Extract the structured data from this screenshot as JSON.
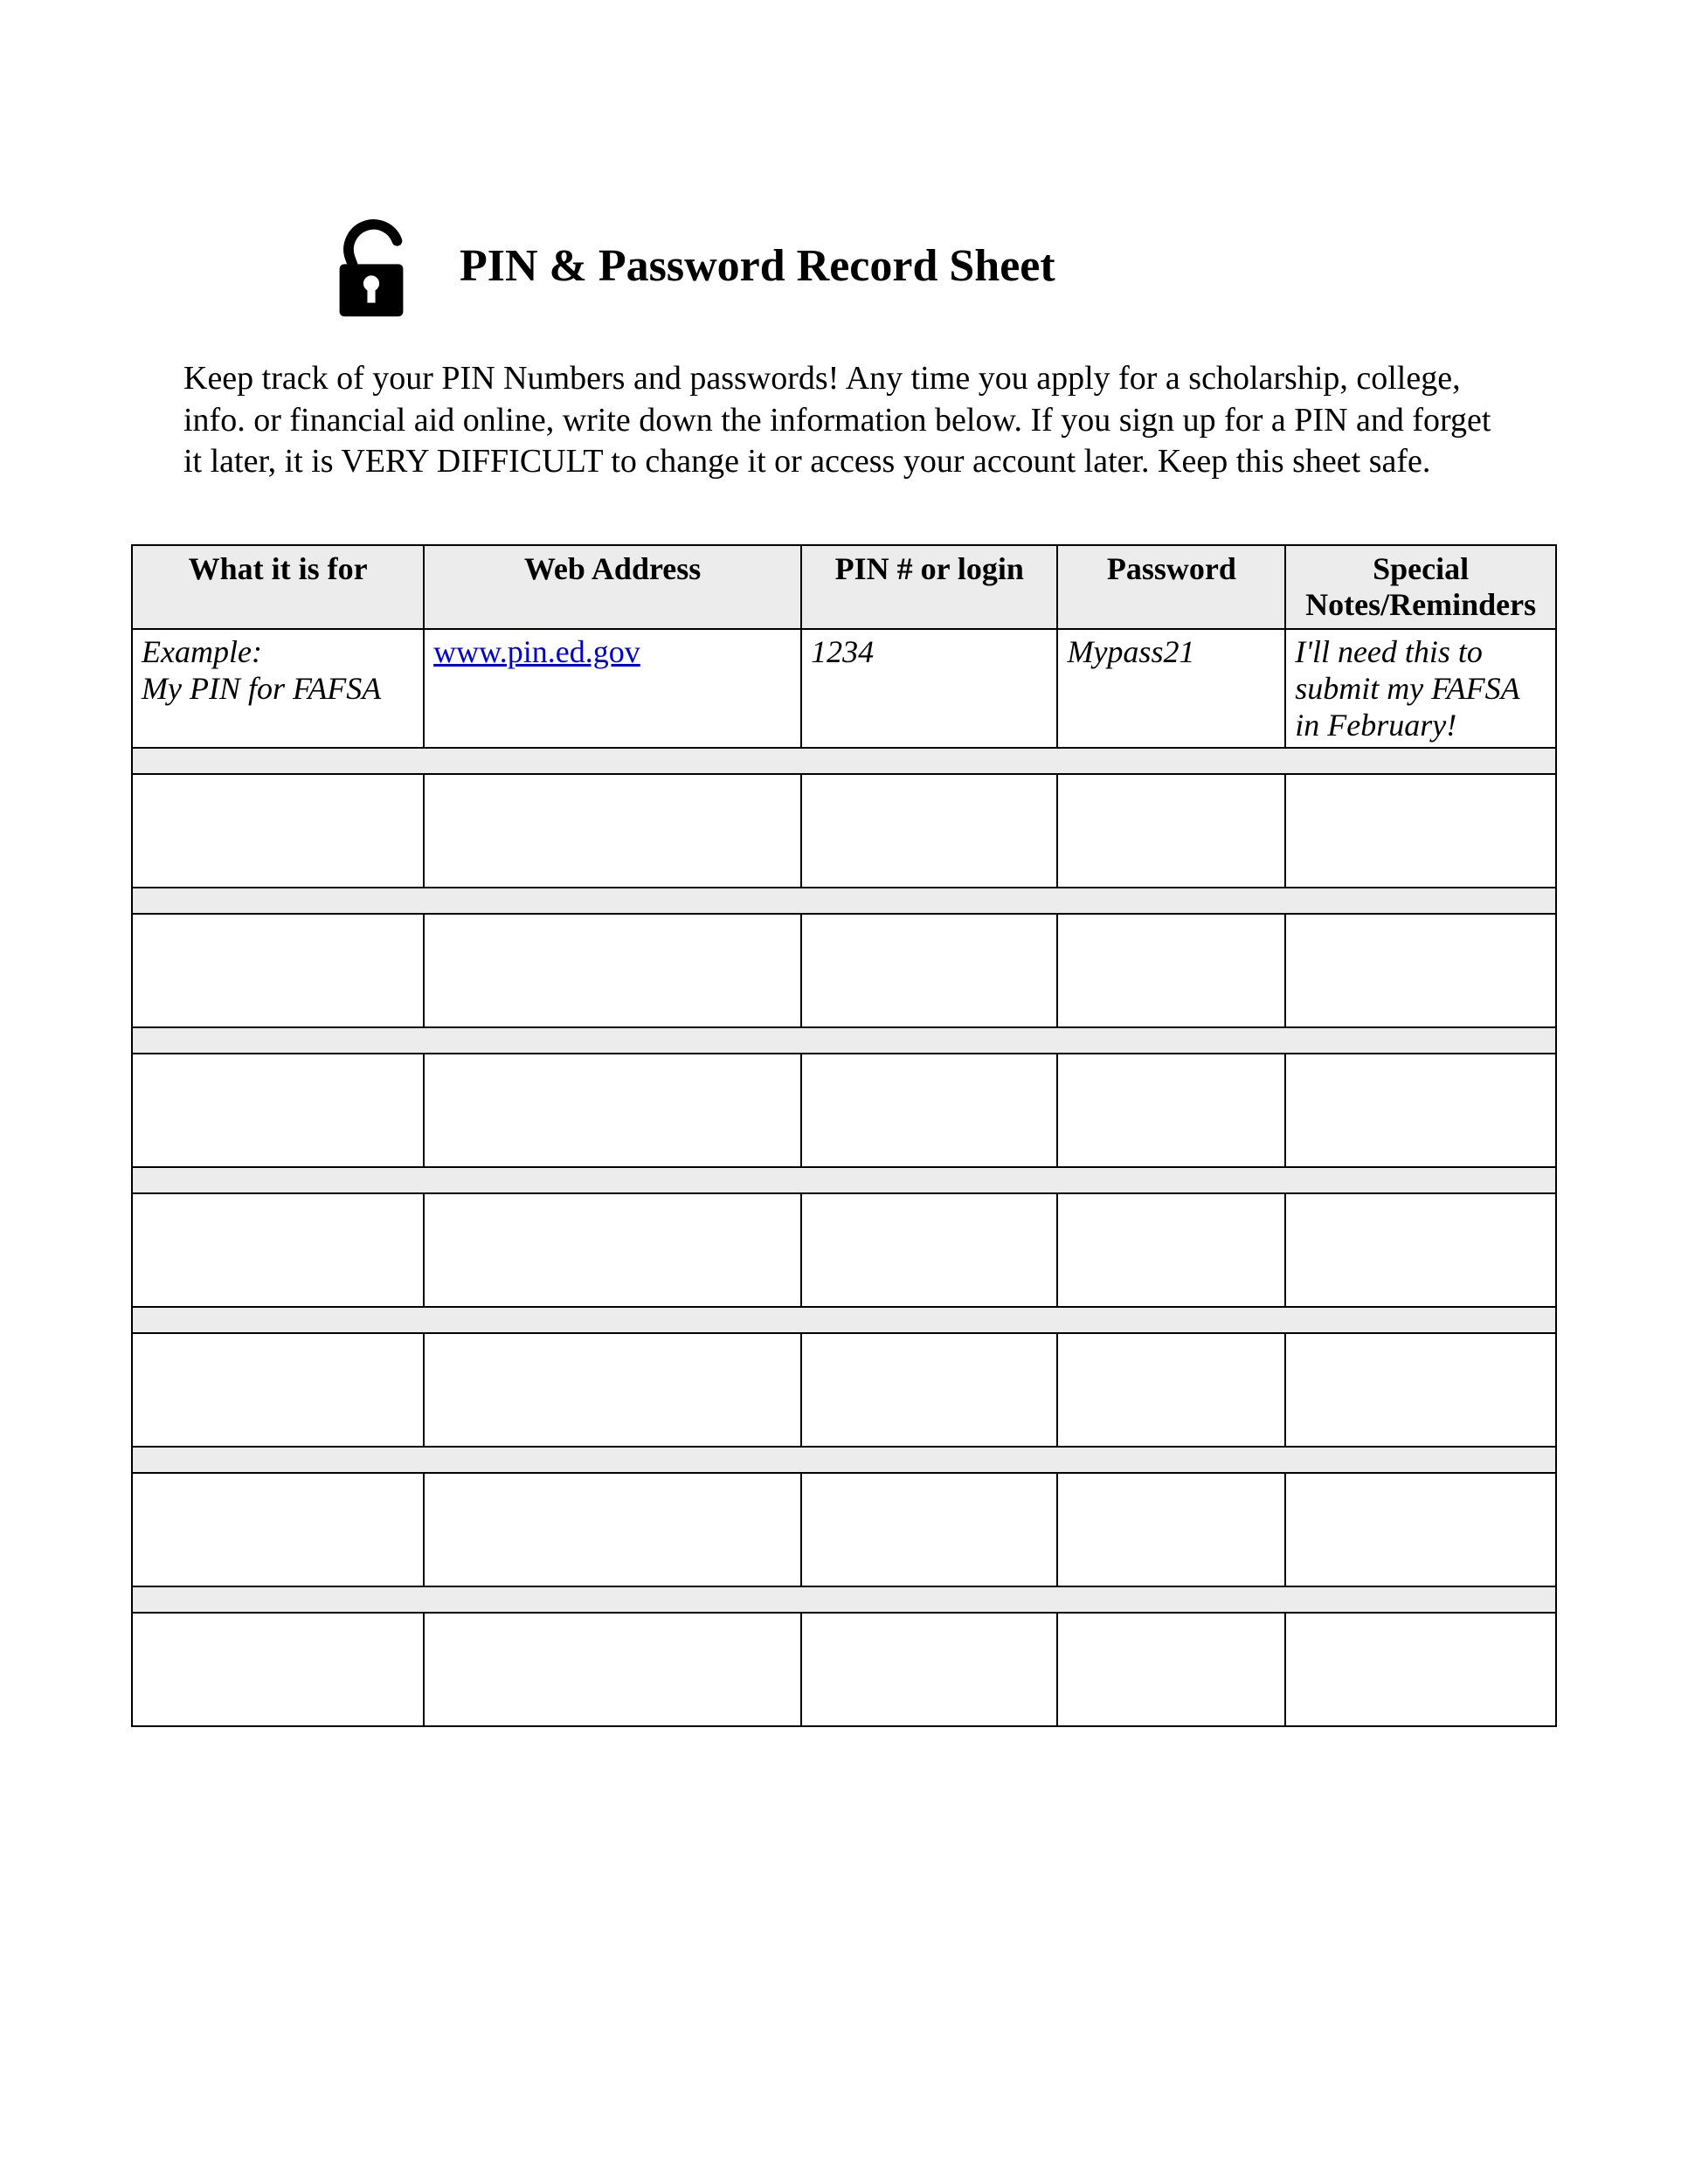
{
  "title": "PIN & Password Record Sheet",
  "intro": "Keep track of your PIN Numbers and passwords! Any time you apply for a scholarship, college, info. or financial aid online, write down the information below. If you sign up for a PIN and forget it later, it is VERY DIFFICULT to change it or access your account later. Keep this sheet safe.",
  "columns": {
    "c1": "What it is for",
    "c2": "Web Address",
    "c3": "PIN # or login",
    "c4": "Password",
    "c5": "Special Notes/Reminders"
  },
  "example": {
    "for_line1": "Example:",
    "for_line2": "My PIN for FAFSA",
    "web": "www.pin.ed.gov",
    "pin": "1234",
    "password": "Mypass21",
    "notes": "I'll need this to submit my FAFSA in February!"
  },
  "blank_rows": 7
}
